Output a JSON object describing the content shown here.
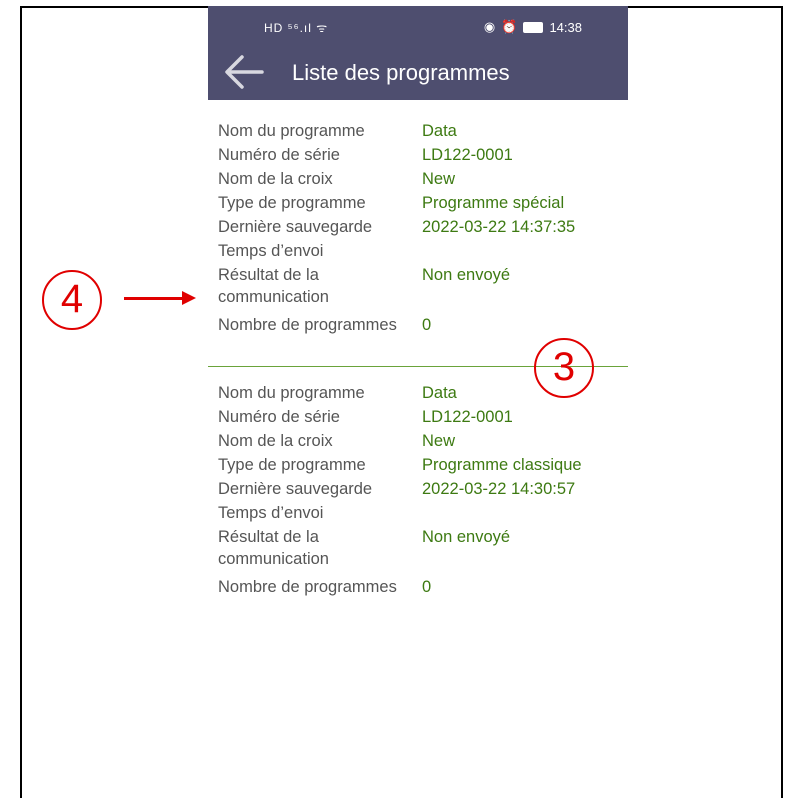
{
  "status_bar": {
    "left": "HD ⁵⁶.ıl ᯤ",
    "time": "14:38"
  },
  "app_bar": {
    "title": "Liste des programmes"
  },
  "entries": [
    {
      "rows": [
        {
          "label": "Nom du programme",
          "value": "Data"
        },
        {
          "label": "Numéro de série",
          "value": "LD122-0001"
        },
        {
          "label": "Nom de la croix",
          "value": "New"
        },
        {
          "label": "Type de programme",
          "value": "Programme spécial"
        },
        {
          "label": "Dernière sauvegarde",
          "value": "2022-03-22 14:37:35"
        },
        {
          "label": "Temps d’envoi",
          "value": ""
        },
        {
          "label": "Résultat de la communication",
          "value": "Non envoyé"
        },
        {
          "label": "Nombre de programmes",
          "value": "0"
        }
      ]
    },
    {
      "rows": [
        {
          "label": "Nom du programme",
          "value": "Data"
        },
        {
          "label": "Numéro de série",
          "value": "LD122-0001"
        },
        {
          "label": "Nom de la croix",
          "value": "New"
        },
        {
          "label": "Type de programme",
          "value": "Programme classique"
        },
        {
          "label": "Dernière sauvegarde",
          "value": "2022-03-22 14:30:57"
        },
        {
          "label": "Temps d’envoi",
          "value": ""
        },
        {
          "label": "Résultat de la communication",
          "value": "Non envoyé"
        },
        {
          "label": "Nombre de programmes",
          "value": "0"
        }
      ]
    }
  ],
  "annotations": {
    "marker_4": "4",
    "marker_3": "3"
  },
  "colors": {
    "app_bar": "#4e4e6f",
    "value_text": "#3d7a12",
    "annotation": "#e00000"
  }
}
